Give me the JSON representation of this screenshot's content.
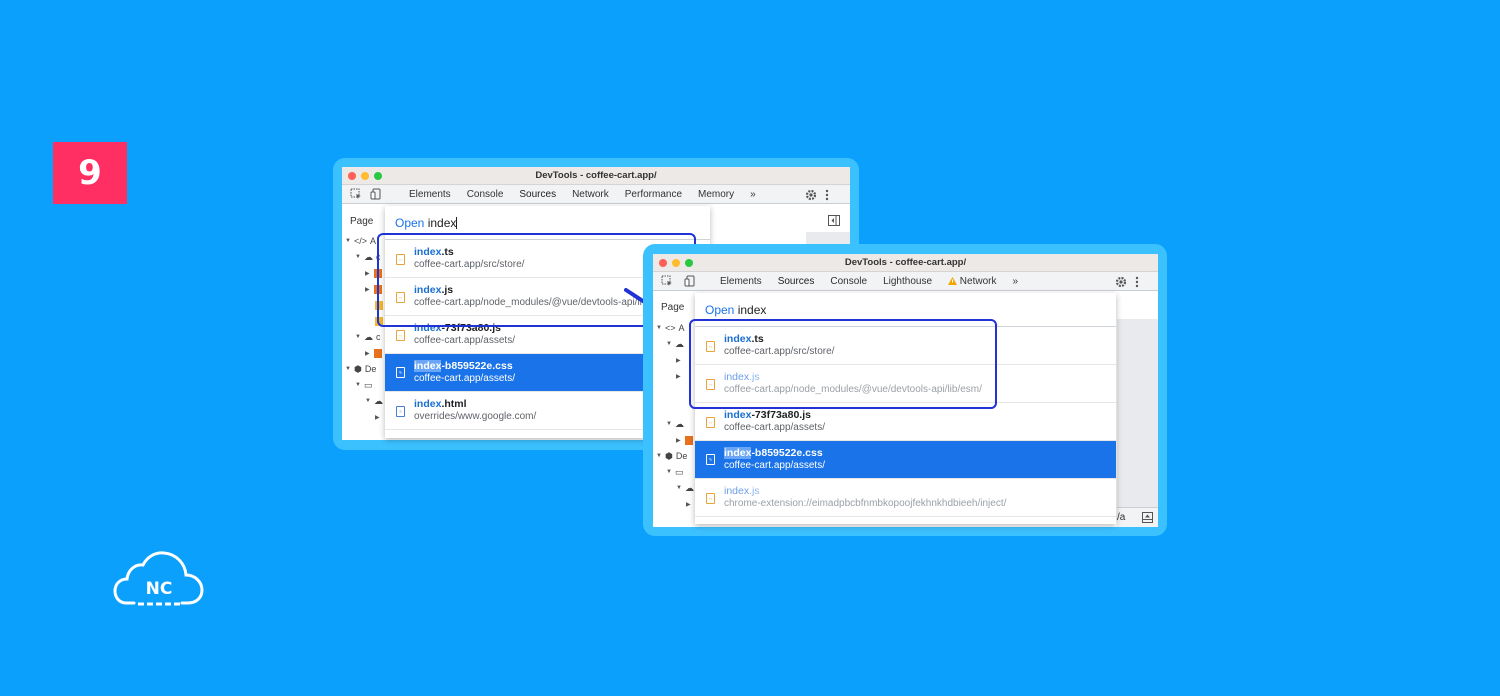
{
  "badge": {
    "number": "9"
  },
  "logo": {
    "text": "NC"
  },
  "window1": {
    "title": "DevTools - coffee-cart.app/",
    "tabs": [
      "Elements",
      "Console",
      "Sources",
      "Network",
      "Performance",
      "Memory"
    ],
    "more": "»",
    "side_tab": "Page",
    "tree_labels": [
      "A",
      "c",
      "",
      "",
      "",
      "c",
      "De",
      "",
      "",
      ""
    ],
    "query": {
      "prefix": "Open",
      "text": "index"
    },
    "results": [
      {
        "hl": "index",
        "rest": ".ts",
        "path": "coffee-cart.app/src/store/"
      },
      {
        "hl": "index",
        "rest": ".js",
        "path": "coffee-cart.app/node_modules/@vue/devtools-api/li"
      },
      {
        "hl": "index",
        "rest": "-73f73a80.js",
        "path": "coffee-cart.app/assets/"
      },
      {
        "hl": "index",
        "rest": "-b859522e.css",
        "path": "coffee-cart.app/assets/"
      },
      {
        "hl": "index",
        "rest": ".html",
        "path": "overrides/www.google.com/"
      }
    ]
  },
  "window2": {
    "title": "DevTools - coffee-cart.app/",
    "tabs": [
      "Elements",
      "Sources",
      "Console",
      "Lighthouse",
      "Network"
    ],
    "warning_icon": "warning-triangle-icon",
    "more": "»",
    "side_tab": "Page",
    "tree_labels": [
      "A",
      "",
      "",
      "",
      "",
      "",
      "De",
      "",
      ""
    ],
    "bottom_text": "/a",
    "query": {
      "prefix": "Open",
      "text": "index"
    },
    "results": [
      {
        "hl": "index",
        "rest": ".ts",
        "path": "coffee-cart.app/src/store/"
      },
      {
        "hl": "index",
        "rest": ".js",
        "path": "coffee-cart.app/node_modules/@vue/devtools-api/lib/esm/"
      },
      {
        "hl": "index",
        "rest": "-73f73a80.js",
        "path": "coffee-cart.app/assets/"
      },
      {
        "hl": "index",
        "rest": "-b859522e.css",
        "path": "coffee-cart.app/assets/"
      },
      {
        "hl": "index",
        "rest": ".js",
        "path": "chrome-extension://eimadpbcbfnmbkopoojfekhnkhdbieeh/inject/"
      }
    ]
  },
  "colors": {
    "background": "#0aa0fb",
    "badge": "#ff2e63",
    "frame": "#3cc1ff",
    "selection": "#1a73e8",
    "highlight_box": "#1f33d6"
  }
}
